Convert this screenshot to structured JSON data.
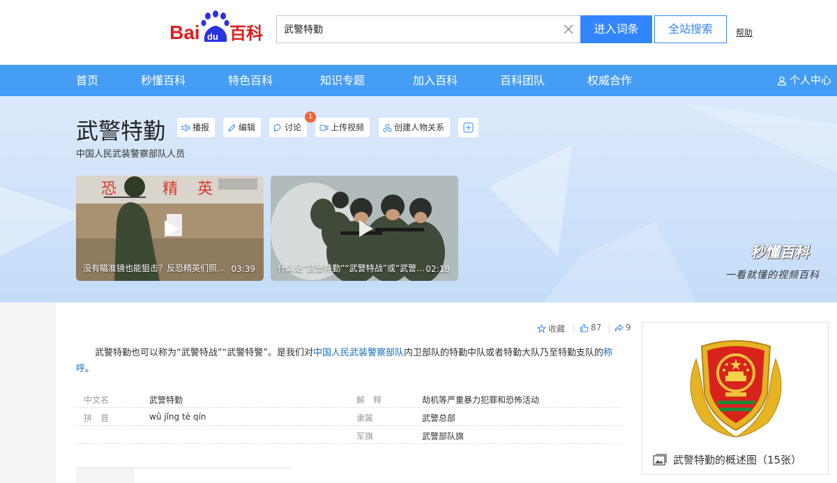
{
  "header": {
    "logo_text_bai": "Bai",
    "logo_text_du": "du",
    "logo_text_baike": "百科",
    "search_value": "武警特勤",
    "enter_button": "进入词条",
    "site_search_button": "全站搜索",
    "help_link": "帮助"
  },
  "nav": {
    "items": [
      "首页",
      "秒懂百科",
      "特色百科",
      "知识专题",
      "加入百科",
      "百科团队",
      "权威合作"
    ],
    "user_center": "个人中心"
  },
  "lemma": {
    "title": "武警特勤",
    "subtitle": "中国人民武装警察部队人员",
    "tools": {
      "broadcast": "播报",
      "edit": "编辑",
      "discuss": "讨论",
      "discuss_badge": "1",
      "upload_video": "上传视频",
      "create_relation": "创建人物关系"
    }
  },
  "videos": [
    {
      "caption": "没有瞄准镜也能狙击？反恐精英们照…",
      "duration": "03:39"
    },
    {
      "caption": "什么是“武警特勤”“武警特战”或“武警…",
      "duration": "02:18"
    }
  ],
  "miaodong": {
    "logo": "秒懂百科",
    "slogan": "一看就懂的视频百科"
  },
  "stats": {
    "collect": "收藏",
    "likes": "87",
    "shares": "9"
  },
  "summary": {
    "part1": "武警特勤也可以称为“武警特战”“武警特警”。是我们对",
    "link1": "中国人民武装警察部队",
    "part2": "内卫部队的特勤中队或者特勤大队乃至特勤支队的",
    "link2": "称呼",
    "part3": "。"
  },
  "basic_info": {
    "left": [
      {
        "name": "中文名",
        "value": "武警特勤"
      },
      {
        "name": "拼　音",
        "value": "wǔ jǐng tè qín"
      }
    ],
    "right": [
      {
        "name": "解　释",
        "value": "劫机等严重暴力犯罪和恐怖活动"
      },
      {
        "name": "隶属",
        "value": "武警总部"
      },
      {
        "name": "军旗",
        "value": "武警部队旗"
      }
    ]
  },
  "album": {
    "caption": "武警特勤的概述图（15张）"
  },
  "colors": {
    "nav_blue": "#459df5",
    "brand_blue": "#3385ff",
    "link_blue": "#136ec2",
    "badge_orange": "#f3643b",
    "logo_red": "#de1e1e"
  }
}
